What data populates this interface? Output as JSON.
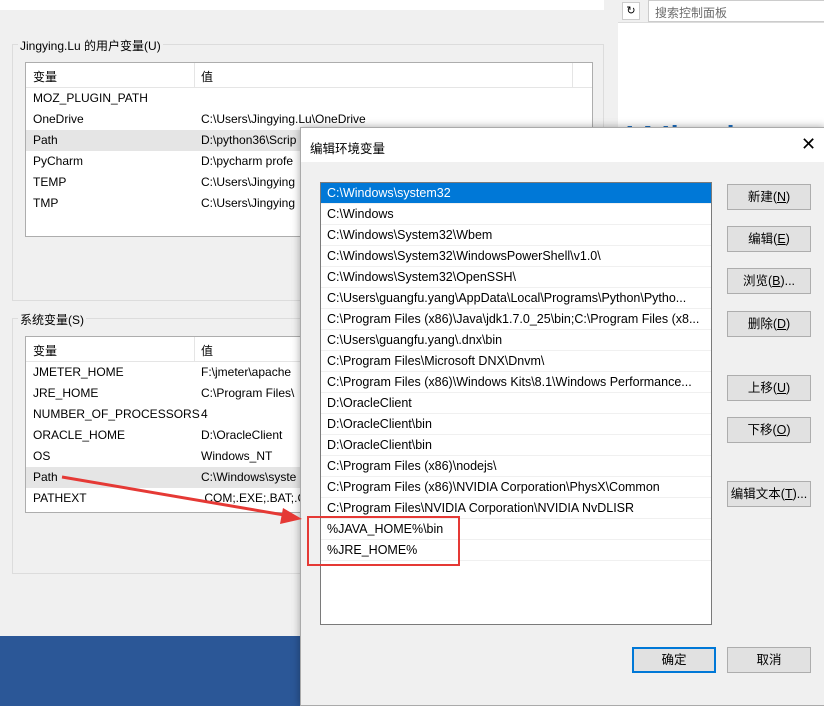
{
  "control_panel": {
    "search_placeholder": "搜索控制面板",
    "refresh_icon": "refresh-icon",
    "banner_text": "Windows 1"
  },
  "env_window": {
    "user_group_label": "Jingying.Lu 的用户变量(U)",
    "user_columns": [
      "变量",
      "值"
    ],
    "user_vars": [
      {
        "name": "MOZ_PLUGIN_PATH",
        "value": ""
      },
      {
        "name": "OneDrive",
        "value": "C:\\Users\\Jingying.Lu\\OneDrive"
      },
      {
        "name": "Path",
        "value": "D:\\python36\\Scrip"
      },
      {
        "name": "PyCharm",
        "value": "D:\\pycharm profe"
      },
      {
        "name": "TEMP",
        "value": "C:\\Users\\Jingying"
      },
      {
        "name": "TMP",
        "value": "C:\\Users\\Jingying"
      }
    ],
    "system_group_label": "系统变量(S)",
    "system_columns": [
      "变量",
      "值"
    ],
    "system_vars": [
      {
        "name": "JMETER_HOME",
        "value": "F:\\jmeter\\apache"
      },
      {
        "name": "JRE_HOME",
        "value": "C:\\Program Files\\"
      },
      {
        "name": "NUMBER_OF_PROCESSORS",
        "value": "4"
      },
      {
        "name": "ORACLE_HOME",
        "value": "D:\\OracleClient"
      },
      {
        "name": "OS",
        "value": "Windows_NT"
      },
      {
        "name": "Path",
        "value": "C:\\Windows\\syste"
      },
      {
        "name": "PATHEXT",
        "value": ".COM;.EXE;.BAT;.C"
      }
    ]
  },
  "dialog": {
    "title": "编辑环境变量",
    "close_icon": "close-icon",
    "path_entries": [
      "C:\\Windows\\system32",
      "C:\\Windows",
      "C:\\Windows\\System32\\Wbem",
      "C:\\Windows\\System32\\WindowsPowerShell\\v1.0\\",
      "C:\\Windows\\System32\\OpenSSH\\",
      "C:\\Users\\guangfu.yang\\AppData\\Local\\Programs\\Python\\Pytho...",
      "C:\\Program Files (x86)\\Java\\jdk1.7.0_25\\bin;C:\\Program Files (x8...",
      "C:\\Users\\guangfu.yang\\.dnx\\bin",
      "C:\\Program Files\\Microsoft DNX\\Dnvm\\",
      "C:\\Program Files (x86)\\Windows Kits\\8.1\\Windows Performance...",
      "D:\\OracleClient",
      "D:\\OracleClient\\bin",
      "D:\\OracleClient\\bin",
      "C:\\Program Files (x86)\\nodejs\\",
      "C:\\Program Files (x86)\\NVIDIA Corporation\\PhysX\\Common",
      "C:\\Program Files\\NVIDIA Corporation\\NVIDIA NvDLISR",
      "%JAVA_HOME%\\bin",
      "%JRE_HOME%"
    ],
    "buttons": {
      "new": {
        "text": "新建(",
        "key": "N",
        "end": ")"
      },
      "edit": {
        "text": "编辑(",
        "key": "E",
        "end": ")"
      },
      "browse": {
        "text": "浏览(",
        "key": "B",
        "end": ")..."
      },
      "delete": {
        "text": "删除(",
        "key": "D",
        "end": ")"
      },
      "move_up": {
        "text": "上移(",
        "key": "U",
        "end": ")"
      },
      "move_down": {
        "text": "下移(",
        "key": "O",
        "end": ")"
      },
      "edit_text": {
        "text": "编辑文本(",
        "key": "T",
        "end": ")..."
      },
      "ok": "确定",
      "cancel": "取消"
    }
  },
  "annotation": {
    "arrow_color": "#e53935",
    "highlight_color": "#e53935"
  }
}
